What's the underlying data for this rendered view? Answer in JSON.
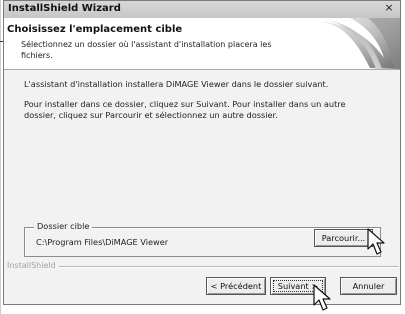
{
  "window": {
    "title": "InstallShield Wizard",
    "close_glyph": "×"
  },
  "header": {
    "title": "Choisissez l'emplacement cible",
    "subtitle": "Sélectionnez un dossier où l'assistant d'installation placera les fichiers.",
    "graphic_icon": "installshield-swoosh-graphic"
  },
  "body": {
    "intro": "L'assistant d'installation installera DiMAGE Viewer dans le dossier suivant.",
    "instructions": "Pour installer dans ce dossier, cliquez sur Suivant. Pour installer dans un autre dossier, cliquez sur Parcourir et sélectionnez un autre dossier."
  },
  "destination": {
    "group_label": "Dossier cible",
    "path": "C:\\Program Files\\DiMAGE Viewer",
    "browse_label": "Parcourir..."
  },
  "footer": {
    "brand": "InstallShield",
    "back_label": "< Précédent",
    "next_label": "Suivant >",
    "cancel_label": "Annuler"
  },
  "cursors": {
    "icon": "arrow-cursor-icon",
    "count": 2
  }
}
